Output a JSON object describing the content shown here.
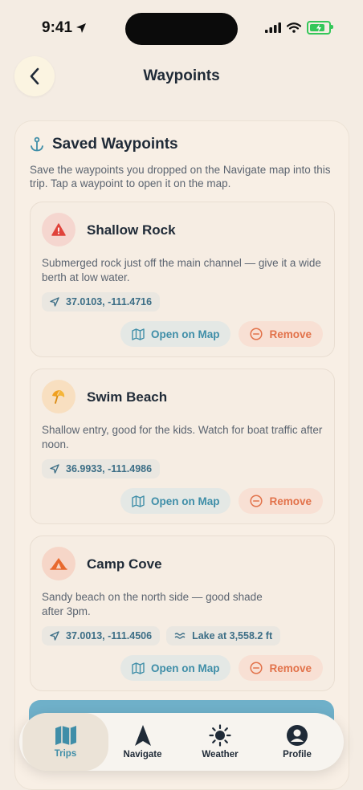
{
  "status": {
    "time": "9:41"
  },
  "header": {
    "title": "Waypoints"
  },
  "panel": {
    "title": "Saved Waypoints",
    "description": "Save the waypoints you dropped on the Navigate map into this trip. Tap a waypoint to open it on the map."
  },
  "waypoints": [
    {
      "name": "Shallow Rock",
      "icon": "warning-icon",
      "note": "Submerged rock just off the main channel — give it a wide berth at low water.",
      "coords": "37.0103, -111.4716",
      "open_label": "Open on Map",
      "remove_label": "Remove",
      "icon_bg": "#f5d6cf"
    },
    {
      "name": "Swim Beach",
      "icon": "beach-umbrella-icon",
      "note": "Shallow entry, good for the kids. Watch for boat traffic after noon.",
      "coords": "36.9933, -111.4986",
      "open_label": "Open on Map",
      "remove_label": "Remove",
      "icon_bg": "#f8dfc0"
    },
    {
      "name": "Camp Cove",
      "icon": "tent-icon",
      "note": "Sandy beach on the north side — good shade after 3pm.",
      "coords": "37.0013, -111.4506",
      "elevation": "Lake at 3,558.2 ft",
      "open_label": "Open on Map",
      "remove_label": "Remove",
      "icon_bg": "#f6d6c8"
    }
  ],
  "tabbar": {
    "tabs": [
      {
        "label": "Trips",
        "icon": "map-icon",
        "active": true
      },
      {
        "label": "Navigate",
        "icon": "navigation-arrow-icon"
      },
      {
        "label": "Weather",
        "icon": "sun-icon"
      },
      {
        "label": "Profile",
        "icon": "person-icon"
      }
    ]
  },
  "colors": {
    "accent": "#3f8ea8",
    "danger": "#e2724a",
    "background": "#f4ece3"
  }
}
